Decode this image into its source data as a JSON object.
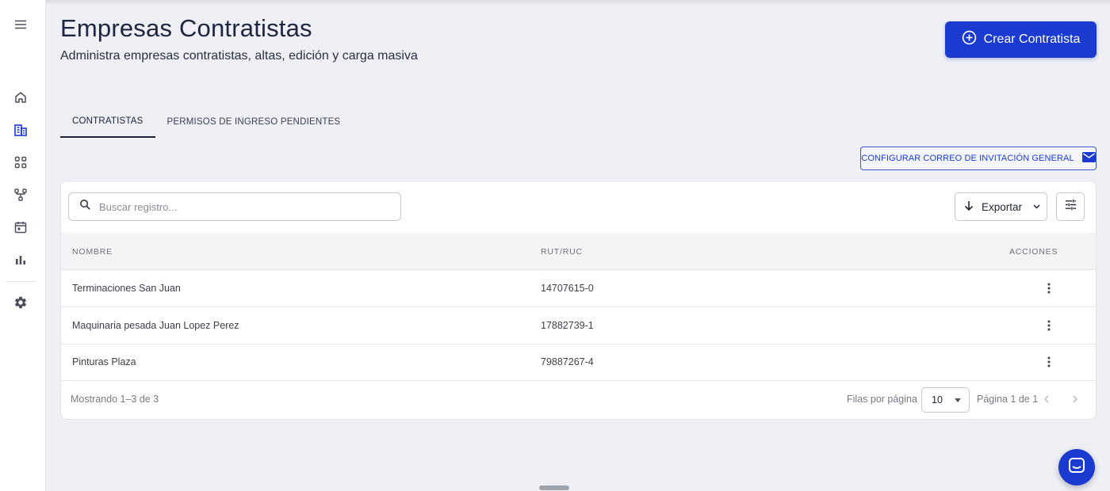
{
  "header": {
    "title": "Empresas Contratistas",
    "subtitle": "Administra empresas contratistas, altas, edición y carga masiva",
    "create_label": "Crear Contratista"
  },
  "sidebar": {
    "items": [
      {
        "icon": "menu-icon"
      },
      {
        "icon": "home-icon"
      },
      {
        "icon": "buildings-icon",
        "active": true
      },
      {
        "icon": "grid-icon"
      },
      {
        "icon": "flow-icon"
      },
      {
        "icon": "calendar-icon"
      },
      {
        "icon": "bar-chart-icon"
      },
      {
        "icon": "gear-icon"
      }
    ]
  },
  "tabs": [
    {
      "label": "CONTRATISTAS",
      "active": true
    },
    {
      "label": "PERMISOS DE INGRESO PENDIENTES",
      "active": false
    }
  ],
  "config_button": {
    "label": "CONFIGURAR CORREO DE INVITACIÓN GENERAL",
    "icon": "mail-icon"
  },
  "toolbar": {
    "search_placeholder": "Buscar registro...",
    "export_label": "Exportar"
  },
  "table": {
    "columns": [
      "NOMBRE",
      "RUT/RUC",
      "ACCIONES"
    ],
    "rows": [
      {
        "nombre": "Terminaciones San Juan",
        "rut": "14707615-0"
      },
      {
        "nombre": "Maquinaria pesada Juan Lopez Perez",
        "rut": "17882739-1"
      },
      {
        "nombre": "Pinturas Plaza",
        "rut": "79887267-4"
      }
    ]
  },
  "footer": {
    "showing": "Mostrando 1–3 de 3",
    "rows_per_page_label": "Filas por página",
    "rows_per_page_value": "10",
    "page_info": "Página 1 de 1"
  },
  "colors": {
    "accent": "#1a3ad0",
    "background": "#eef0f6",
    "sidebar_icon": "#4a4f5c"
  }
}
